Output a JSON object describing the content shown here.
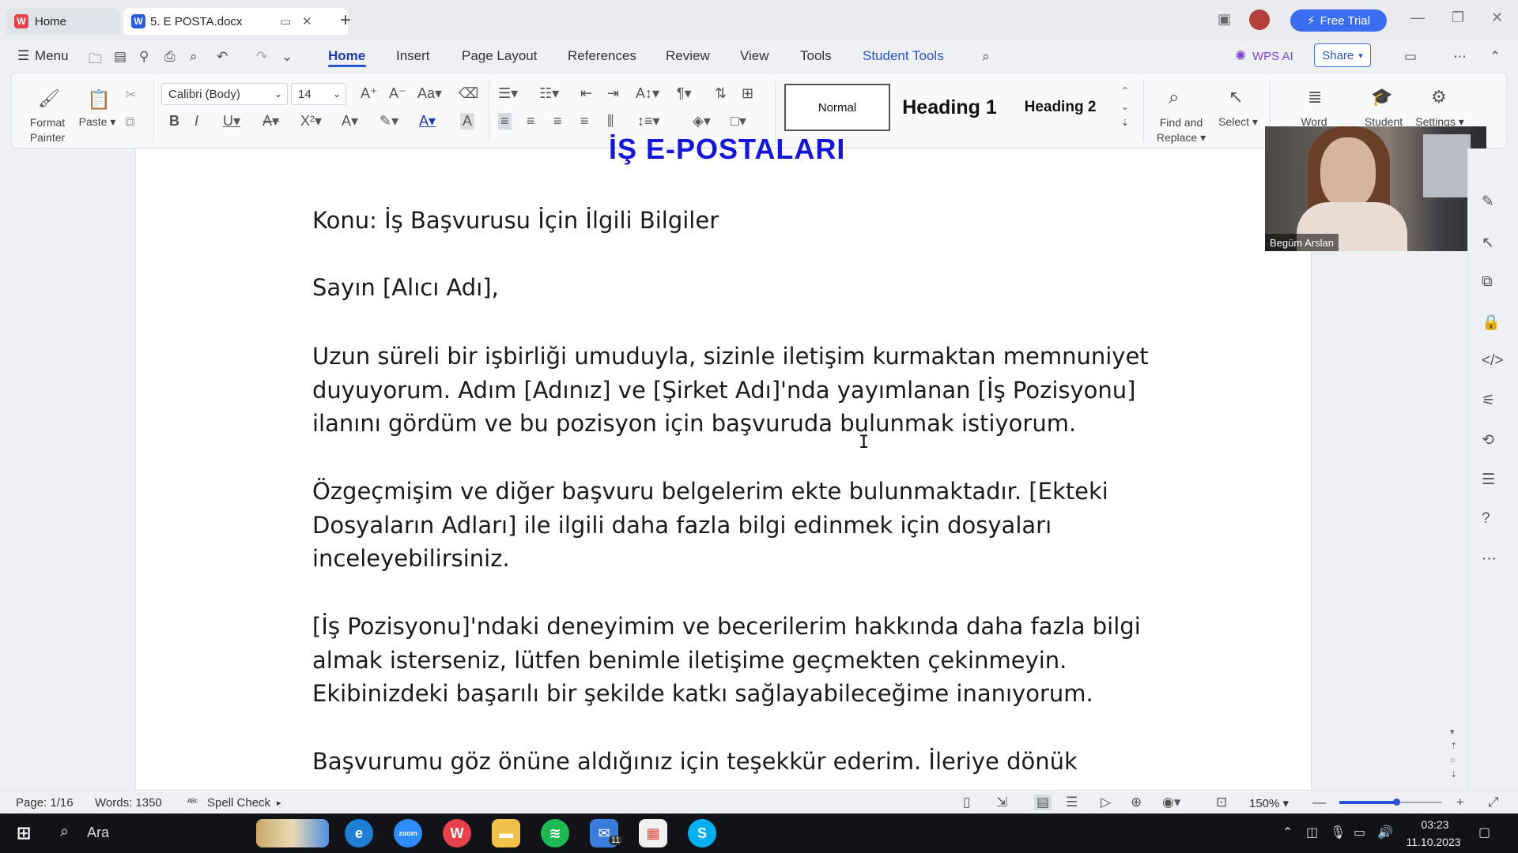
{
  "tabs": [
    {
      "label": "Home",
      "icon": "wps-logo-icon"
    },
    {
      "label": "5. E POSTA.docx",
      "icon": "word-doc-icon"
    }
  ],
  "titlebar": {
    "free_trial": "Free Trial"
  },
  "menu": {
    "menu_label": "Menu",
    "items": [
      "Home",
      "Insert",
      "Page Layout",
      "References",
      "Review",
      "View",
      "Tools",
      "Student Tools"
    ],
    "wps_ai": "WPS AI",
    "share": "Share"
  },
  "ribbon": {
    "format_painter": [
      "Format",
      "Painter"
    ],
    "paste": "Paste",
    "font_name": "Calibri (Body)",
    "font_size": "14",
    "styles": {
      "normal": "Normal",
      "heading1": "Heading 1",
      "heading2": "Heading 2"
    },
    "find_replace": [
      "Find and",
      "Replace"
    ],
    "select": "Select",
    "word": "Word",
    "student": "Student",
    "settings": "Settings"
  },
  "document": {
    "title": "İŞ E-POSTALARI",
    "subject": "Konu: İş Başvurusu İçin İlgili Bilgiler",
    "greeting": "Sayın [Alıcı Adı],",
    "para1": [
      "Uzun süreli bir işbirliği umuduyla, sizinle iletişim kurmaktan memnuniyet",
      "duyuyorum. Adım [Adınız] ve [Şirket Adı]'nda yayımlanan [İş Pozisyonu]",
      "ilanını gördüm ve bu pozisyon için başvuruda bulunmak istiyorum."
    ],
    "para2": [
      "Özgeçmişim ve diğer başvuru belgelerim ekte bulunmaktadır. [Ekteki",
      "Dosyaların Adları] ile ilgili daha fazla bilgi edinmek için dosyaları",
      "inceleyebilirsiniz."
    ],
    "para3": [
      "[İş Pozisyonu]'ndaki deneyimim ve becerilerim hakkında daha fazla bilgi",
      "almak isterseniz, lütfen benimle iletişime geçmekten çekinmeyin.",
      "Ekibinizdeki başarılı bir şekilde katkı sağlayabileceğime inanıyorum."
    ],
    "para4": [
      "Başvurumu göz önüne aldığınız için teşekkür ederim. İleriye dönük"
    ]
  },
  "webcam": {
    "name": "Begüm Arslan"
  },
  "status": {
    "page": "Page: 1/16",
    "words": "Words: 1350",
    "spell_check": "Spell Check",
    "zoom": "150%",
    "zoom_fraction": 0.55
  },
  "taskbar": {
    "search": "Ara",
    "mail_badge": "11",
    "time": "03:23",
    "date": "11.10.2023"
  },
  "colors": {
    "accent": "#2c53d6",
    "title_blue": "#1515d8",
    "free_trial": "#3b6df0"
  }
}
